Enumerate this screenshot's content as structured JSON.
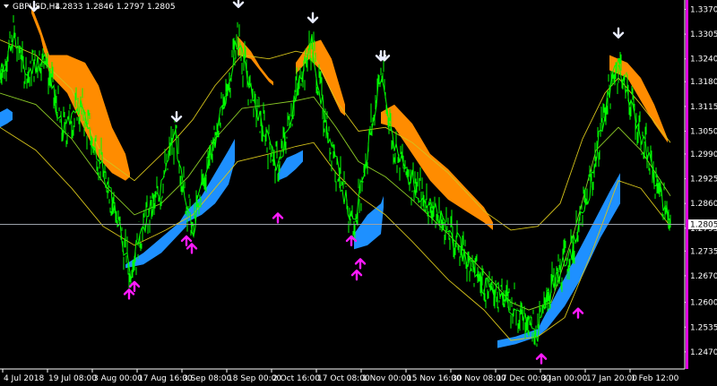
{
  "header": {
    "menu_icon": "triangle-down-icon",
    "symbol_label": "GBPUSD,H4",
    "ohlc": "1.2833 1.2846 1.2797 1.2805"
  },
  "chart_data": {
    "type": "line",
    "ylim": [
      1.2425,
      1.339
    ],
    "y_ticks": [
      "1.3370",
      "1.3305",
      "1.3240",
      "1.3180",
      "1.3115",
      "1.3050",
      "1.2990",
      "1.2925",
      "1.2860",
      "1.2795",
      "1.2735",
      "1.2670",
      "1.2600",
      "1.2535",
      "1.2470"
    ],
    "x_ticks": [
      "4 Jul 2018",
      "19 Jul 08:00",
      "3 Aug 00:00",
      "17 Aug 16:00",
      "3 Sep 08:00",
      "18 Sep 00:00",
      "2 Oct 16:00",
      "17 Oct 08:00",
      "1 Nov 00:00",
      "15 Nov 16:00",
      "30 Nov 08:00",
      "17 Dec 00:00",
      "3 Jan 00:00",
      "17 Jan 20:00",
      "1 Feb 12:00"
    ],
    "current_price": "1.2805",
    "current_price_value": 1.2805,
    "price_path": [
      [
        0,
        1.319
      ],
      [
        15,
        1.33
      ],
      [
        30,
        1.32
      ],
      [
        50,
        1.325
      ],
      [
        70,
        1.305
      ],
      [
        90,
        1.311
      ],
      [
        110,
        1.298
      ],
      [
        130,
        1.283
      ],
      [
        145,
        1.268
      ],
      [
        160,
        1.28
      ],
      [
        180,
        1.29
      ],
      [
        195,
        1.3045
      ],
      [
        205,
        1.29
      ],
      [
        215,
        1.279
      ],
      [
        230,
        1.295
      ],
      [
        250,
        1.312
      ],
      [
        265,
        1.33
      ],
      [
        280,
        1.315
      ],
      [
        295,
        1.305
      ],
      [
        310,
        1.295
      ],
      [
        330,
        1.315
      ],
      [
        348,
        1.328
      ],
      [
        365,
        1.305
      ],
      [
        380,
        1.292
      ],
      [
        395,
        1.279
      ],
      [
        410,
        1.3
      ],
      [
        425,
        1.321
      ],
      [
        440,
        1.3
      ],
      [
        460,
        1.292
      ],
      [
        480,
        1.285
      ],
      [
        500,
        1.279
      ],
      [
        520,
        1.272
      ],
      [
        540,
        1.265
      ],
      [
        560,
        1.262
      ],
      [
        580,
        1.258
      ],
      [
        600,
        1.252
      ],
      [
        610,
        1.262
      ],
      [
        625,
        1.268
      ],
      [
        640,
        1.275
      ],
      [
        660,
        1.292
      ],
      [
        675,
        1.311
      ],
      [
        690,
        1.323
      ],
      [
        705,
        1.312
      ],
      [
        720,
        1.3
      ],
      [
        735,
        1.29
      ],
      [
        748,
        1.2805
      ]
    ],
    "ma_path": [
      [
        0,
        1.315
      ],
      [
        40,
        1.312
      ],
      [
        80,
        1.303
      ],
      [
        120,
        1.29
      ],
      [
        150,
        1.283
      ],
      [
        180,
        1.286
      ],
      [
        210,
        1.293
      ],
      [
        240,
        1.303
      ],
      [
        270,
        1.311
      ],
      [
        300,
        1.312
      ],
      [
        330,
        1.313
      ],
      [
        350,
        1.314
      ],
      [
        375,
        1.306
      ],
      [
        400,
        1.297
      ],
      [
        430,
        1.293
      ],
      [
        460,
        1.287
      ],
      [
        500,
        1.278
      ],
      [
        540,
        1.268
      ],
      [
        570,
        1.26
      ],
      [
        590,
        1.258
      ],
      [
        615,
        1.26
      ],
      [
        640,
        1.278
      ],
      [
        665,
        1.3
      ],
      [
        690,
        1.306
      ],
      [
        715,
        1.3
      ],
      [
        748,
        1.288
      ]
    ],
    "upper_band_path": [
      [
        0,
        1.329
      ],
      [
        40,
        1.325
      ],
      [
        80,
        1.316
      ],
      [
        115,
        1.298
      ],
      [
        150,
        1.292
      ],
      [
        185,
        1.3
      ],
      [
        215,
        1.308
      ],
      [
        240,
        1.317
      ],
      [
        270,
        1.325
      ],
      [
        300,
        1.324
      ],
      [
        330,
        1.326
      ],
      [
        350,
        1.325
      ],
      [
        375,
        1.313
      ],
      [
        400,
        1.305
      ],
      [
        430,
        1.306
      ],
      [
        460,
        1.302
      ],
      [
        500,
        1.294
      ],
      [
        540,
        1.284
      ],
      [
        570,
        1.279
      ],
      [
        600,
        1.28
      ],
      [
        625,
        1.286
      ],
      [
        650,
        1.303
      ],
      [
        675,
        1.315
      ],
      [
        690,
        1.319
      ],
      [
        715,
        1.312
      ],
      [
        748,
        1.302
      ]
    ],
    "lower_band_path": [
      [
        0,
        1.306
      ],
      [
        40,
        1.3
      ],
      [
        80,
        1.29
      ],
      [
        115,
        1.28
      ],
      [
        150,
        1.275
      ],
      [
        185,
        1.279
      ],
      [
        215,
        1.283
      ],
      [
        240,
        1.29
      ],
      [
        265,
        1.297
      ],
      [
        300,
        1.299
      ],
      [
        330,
        1.301
      ],
      [
        350,
        1.302
      ],
      [
        375,
        1.294
      ],
      [
        400,
        1.288
      ],
      [
        430,
        1.283
      ],
      [
        460,
        1.276
      ],
      [
        500,
        1.266
      ],
      [
        540,
        1.258
      ],
      [
        570,
        1.25
      ],
      [
        600,
        1.251
      ],
      [
        630,
        1.256
      ],
      [
        660,
        1.273
      ],
      [
        690,
        1.292
      ],
      [
        715,
        1.29
      ],
      [
        748,
        1.28
      ]
    ],
    "sell_ribbons": [
      {
        "top": [
          [
            35,
            1.338
          ],
          [
            45,
            1.332
          ],
          [
            55,
            1.325
          ],
          [
            75,
            1.325
          ],
          [
            95,
            1.323
          ],
          [
            110,
            1.317
          ],
          [
            125,
            1.306
          ],
          [
            140,
            1.299
          ],
          [
            145,
            1.294
          ]
        ],
        "bottom": [
          [
            35,
            1.336
          ],
          [
            45,
            1.33
          ],
          [
            55,
            1.32
          ],
          [
            75,
            1.315
          ],
          [
            95,
            1.305
          ],
          [
            110,
            1.298
          ],
          [
            125,
            1.294
          ],
          [
            140,
            1.292
          ],
          [
            145,
            1.293
          ]
        ]
      },
      {
        "top": [
          [
            265,
            1.33
          ],
          [
            280,
            1.326
          ],
          [
            290,
            1.322
          ],
          [
            300,
            1.319
          ],
          [
            305,
            1.318
          ]
        ],
        "bottom": [
          [
            265,
            1.325
          ],
          [
            280,
            1.324
          ],
          [
            290,
            1.321
          ],
          [
            300,
            1.318
          ],
          [
            305,
            1.317
          ]
        ]
      },
      {
        "top": [
          [
            330,
            1.323
          ],
          [
            345,
            1.328
          ],
          [
            358,
            1.329
          ],
          [
            370,
            1.324
          ],
          [
            380,
            1.316
          ],
          [
            385,
            1.312
          ]
        ],
        "bottom": [
          [
            330,
            1.32
          ],
          [
            345,
            1.324
          ],
          [
            358,
            1.321
          ],
          [
            370,
            1.315
          ],
          [
            380,
            1.31
          ],
          [
            385,
            1.309
          ]
        ]
      },
      {
        "top": [
          [
            425,
            1.31
          ],
          [
            440,
            1.312
          ],
          [
            460,
            1.307
          ],
          [
            480,
            1.299
          ],
          [
            500,
            1.295
          ],
          [
            520,
            1.29
          ],
          [
            540,
            1.285
          ],
          [
            550,
            1.281
          ]
        ],
        "bottom": [
          [
            425,
            1.307
          ],
          [
            440,
            1.306
          ],
          [
            460,
            1.299
          ],
          [
            480,
            1.292
          ],
          [
            500,
            1.287
          ],
          [
            520,
            1.284
          ],
          [
            540,
            1.281
          ],
          [
            550,
            1.279
          ]
        ]
      },
      {
        "top": [
          [
            680,
            1.325
          ],
          [
            700,
            1.323
          ],
          [
            715,
            1.319
          ],
          [
            730,
            1.312
          ],
          [
            745,
            1.303
          ]
        ],
        "bottom": [
          [
            680,
            1.321
          ],
          [
            700,
            1.319
          ],
          [
            715,
            1.313
          ],
          [
            730,
            1.307
          ],
          [
            745,
            1.302
          ]
        ]
      }
    ],
    "buy_ribbons": [
      {
        "top": [
          [
            0,
            1.31
          ],
          [
            8,
            1.311
          ],
          [
            14,
            1.31
          ]
        ],
        "bottom": [
          [
            0,
            1.306
          ],
          [
            8,
            1.307
          ],
          [
            14,
            1.308
          ]
        ]
      },
      {
        "top": [
          [
            140,
            1.27
          ],
          [
            160,
            1.273
          ],
          [
            180,
            1.277
          ],
          [
            200,
            1.281
          ],
          [
            208,
            1.284
          ]
        ],
        "bottom": [
          [
            140,
            1.269
          ],
          [
            160,
            1.27
          ],
          [
            180,
            1.273
          ],
          [
            200,
            1.278
          ],
          [
            208,
            1.28
          ]
        ]
      },
      {
        "top": [
          [
            208,
            1.284
          ],
          [
            225,
            1.288
          ],
          [
            240,
            1.294
          ],
          [
            255,
            1.3
          ],
          [
            262,
            1.303
          ]
        ],
        "bottom": [
          [
            208,
            1.281
          ],
          [
            225,
            1.283
          ],
          [
            240,
            1.286
          ],
          [
            255,
            1.291
          ],
          [
            262,
            1.297
          ]
        ]
      },
      {
        "top": [
          [
            310,
            1.294
          ],
          [
            320,
            1.298
          ],
          [
            330,
            1.299
          ],
          [
            338,
            1.3
          ]
        ],
        "bottom": [
          [
            310,
            1.292
          ],
          [
            320,
            1.293
          ],
          [
            330,
            1.295
          ],
          [
            338,
            1.297
          ]
        ]
      },
      {
        "top": [
          [
            395,
            1.278
          ],
          [
            410,
            1.283
          ],
          [
            425,
            1.286
          ],
          [
            428,
            1.288
          ]
        ],
        "bottom": [
          [
            395,
            1.274
          ],
          [
            410,
            1.275
          ],
          [
            425,
            1.278
          ],
          [
            428,
            1.285
          ]
        ]
      },
      {
        "top": [
          [
            555,
            1.25
          ],
          [
            575,
            1.251
          ],
          [
            600,
            1.253
          ],
          [
            620,
            1.262
          ],
          [
            640,
            1.271
          ],
          [
            660,
            1.28
          ],
          [
            680,
            1.289
          ],
          [
            692,
            1.294
          ]
        ],
        "bottom": [
          [
            555,
            1.248
          ],
          [
            575,
            1.249
          ],
          [
            600,
            1.251
          ],
          [
            610,
            1.253
          ],
          [
            630,
            1.259
          ],
          [
            650,
            1.267
          ],
          [
            670,
            1.277
          ],
          [
            692,
            1.286
          ]
        ]
      }
    ],
    "sell_arrows": [
      [
        38,
        1.339
      ],
      [
        197,
        1.31
      ],
      [
        266,
        1.34
      ],
      [
        349,
        1.336
      ],
      [
        425,
        1.326
      ],
      [
        429,
        1.326
      ],
      [
        690,
        1.332
      ]
    ],
    "buy_arrows": [
      [
        144,
        1.261
      ],
      [
        150,
        1.263
      ],
      [
        208,
        1.275
      ],
      [
        214,
        1.273
      ],
      [
        310,
        1.281
      ],
      [
        392,
        1.275
      ],
      [
        398,
        1.266
      ],
      [
        402,
        1.269
      ],
      [
        604,
        1.244
      ],
      [
        645,
        1.256
      ]
    ],
    "colors": {
      "background": "#000000",
      "price": "#00ff00",
      "bands": "#d4c21a",
      "ma": "#8ac926",
      "sell_ribbon": "#ff8c00",
      "buy_ribbon": "#1e90ff",
      "sell_arrow": "#e8ecff",
      "buy_arrow": "#ff1aff",
      "axis": "#ffffff",
      "current_line": "#9aa0a8",
      "scroll_bar": "#e000e0"
    }
  }
}
